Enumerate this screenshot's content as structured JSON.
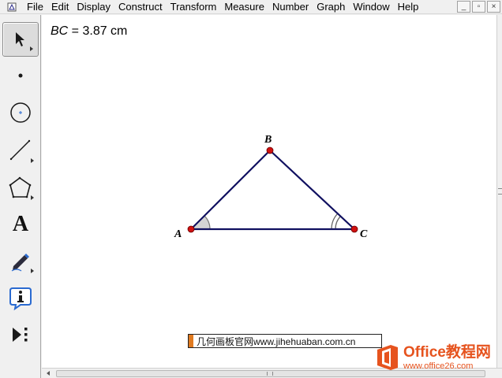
{
  "menubar": {
    "items": [
      "File",
      "Edit",
      "Display",
      "Construct",
      "Transform",
      "Measure",
      "Number",
      "Graph",
      "Window",
      "Help"
    ],
    "window_controls": {
      "minimize": "_",
      "restore": "▫",
      "close": "×"
    }
  },
  "toolbox": {
    "tools": [
      {
        "name": "selection-arrow-tool",
        "active": true
      },
      {
        "name": "point-tool",
        "active": false
      },
      {
        "name": "compass-tool",
        "active": false
      },
      {
        "name": "straightedge-tool",
        "active": false
      },
      {
        "name": "polygon-tool",
        "active": false
      },
      {
        "name": "text-tool",
        "label": "A",
        "active": false
      },
      {
        "name": "marker-tool",
        "active": false
      },
      {
        "name": "information-tool",
        "active": false
      },
      {
        "name": "custom-tool",
        "active": false
      }
    ]
  },
  "measurement": {
    "variable": "BC",
    "equals": " = ",
    "value": "3.87 cm"
  },
  "figure": {
    "points": [
      {
        "label": "A"
      },
      {
        "label": "B"
      },
      {
        "label": "C"
      }
    ],
    "point_color": "#d01010",
    "segment_color": "#101060",
    "angle_mark_color": "#a0a0a0"
  },
  "watermarks": {
    "site": "几何画板官网www.jihehuaban.com.cn",
    "office_brand_en": "Office",
    "office_brand_cn": "教程网",
    "office_url": "www.office26.com",
    "brand_color": "#e6531e"
  }
}
